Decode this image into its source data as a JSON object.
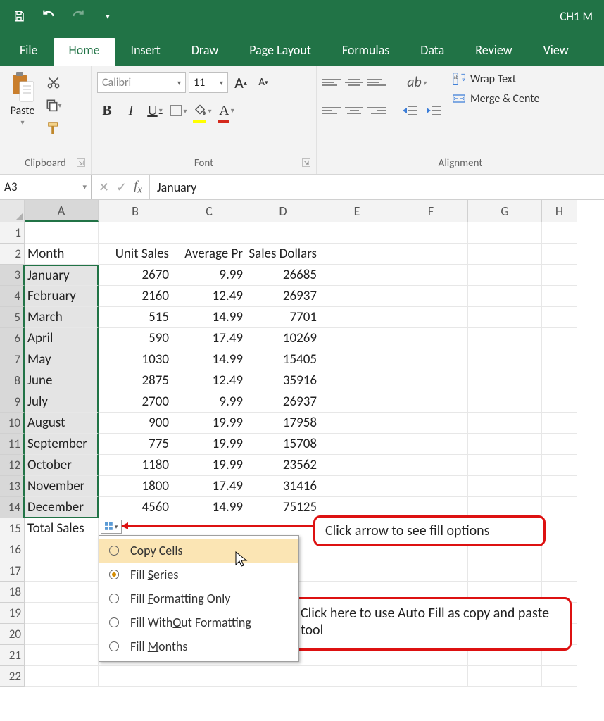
{
  "titlebar": {
    "doc_title": "CH1 M"
  },
  "tabs": [
    "File",
    "Home",
    "Insert",
    "Draw",
    "Page Layout",
    "Formulas",
    "Data",
    "Review",
    "View"
  ],
  "active_tab": "Home",
  "ribbon": {
    "clipboard": {
      "paste_label": "Paste",
      "group_label": "Clipboard"
    },
    "font": {
      "group_label": "Font",
      "font_name": "Calibri",
      "font_size": "11",
      "bold": "B",
      "italic": "I",
      "underline": "U"
    },
    "alignment": {
      "group_label": "Alignment",
      "wrap_label": "Wrap Text",
      "merge_label": "Merge & Cente"
    }
  },
  "formula_bar": {
    "cell_ref": "A3",
    "formula": "January"
  },
  "columns": [
    "A",
    "B",
    "C",
    "D",
    "E",
    "F",
    "G",
    "H"
  ],
  "headers": [
    "Month",
    "Unit Sales",
    "Average Pr",
    "Sales Dollars"
  ],
  "data_rows": [
    {
      "m": "January",
      "u": "2670",
      "a": "9.99",
      "s": "26685"
    },
    {
      "m": "February",
      "u": "2160",
      "a": "12.49",
      "s": "26937"
    },
    {
      "m": "March",
      "u": "515",
      "a": "14.99",
      "s": "7701"
    },
    {
      "m": "April",
      "u": "590",
      "a": "17.49",
      "s": "10269"
    },
    {
      "m": "May",
      "u": "1030",
      "a": "14.99",
      "s": "15405"
    },
    {
      "m": "June",
      "u": "2875",
      "a": "12.49",
      "s": "35916"
    },
    {
      "m": "July",
      "u": "2700",
      "a": "9.99",
      "s": "26937"
    },
    {
      "m": "August",
      "u": "900",
      "a": "19.99",
      "s": "17958"
    },
    {
      "m": "September",
      "u": "775",
      "a": "19.99",
      "s": "15708"
    },
    {
      "m": "October",
      "u": "1180",
      "a": "19.99",
      "s": "23562"
    },
    {
      "m": "November",
      "u": "1800",
      "a": "17.49",
      "s": "31416"
    },
    {
      "m": "December",
      "u": "4560",
      "a": "14.99",
      "s": "75125"
    }
  ],
  "total_label": "Total Sales",
  "autofill_menu": {
    "items": [
      {
        "label_prefix": "C",
        "label_rest": "opy Cells"
      },
      {
        "label_prefix": "S",
        "label_rest_before": "Fill ",
        "label_rest": "eries"
      },
      {
        "label_prefix": "F",
        "label_rest_before": "Fill ",
        "label_rest": "ormatting Only"
      },
      {
        "label_prefix": "O",
        "label_before": "Fill With",
        "label_rest": "ut Formatting"
      },
      {
        "label_prefix": "M",
        "label_rest_before": "Fill ",
        "label_rest": "onths"
      }
    ]
  },
  "callout1": "Click arrow to see fill options",
  "callout2": "Click here to use Auto Fill as copy and paste tool"
}
